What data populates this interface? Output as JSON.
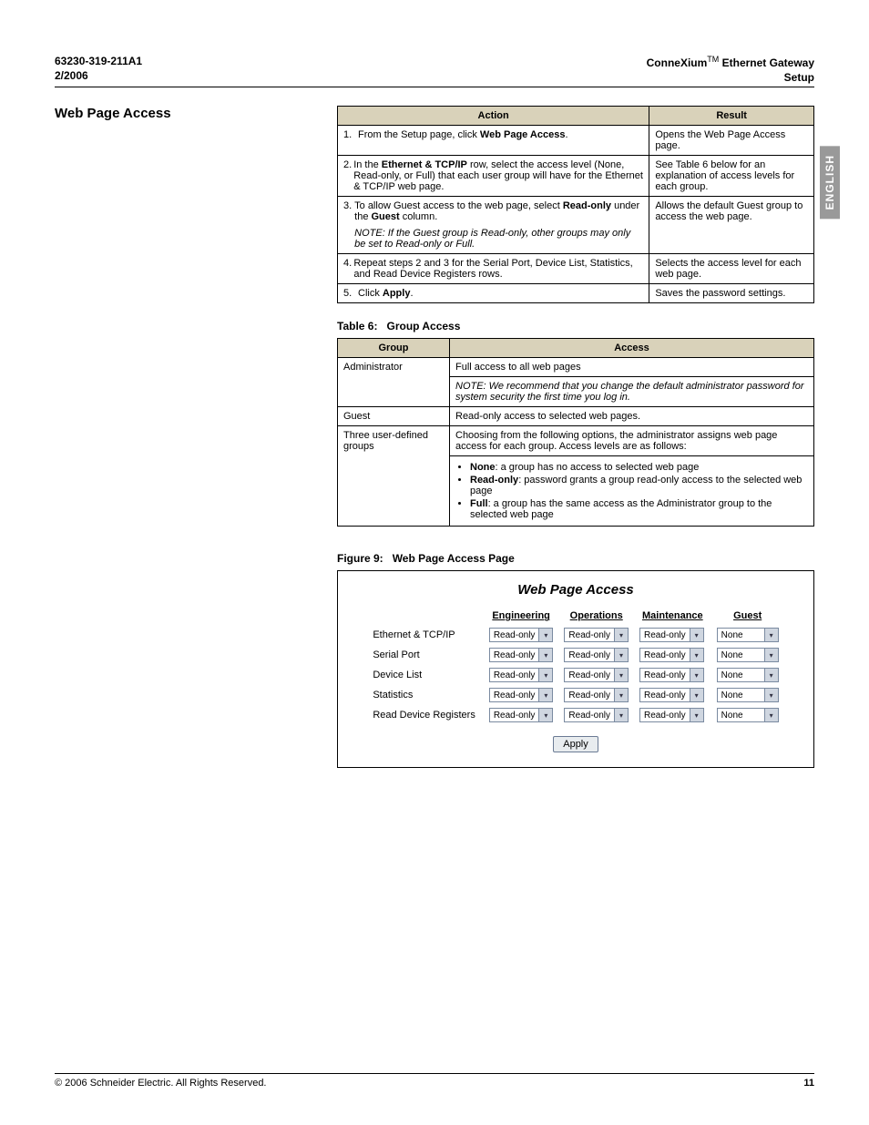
{
  "header": {
    "doc_id": "63230-319-211A1",
    "date": "2/2006",
    "product_pre": "ConneXium",
    "product_tm": "TM",
    "product_post": " Ethernet Gateway",
    "subtitle": "Setup"
  },
  "side_tab": "ENGLISH",
  "section_title": "Web Page Access",
  "action_result": {
    "col_action": "Action",
    "col_result": "Result",
    "rows": [
      {
        "num": "1.",
        "action_pre": "From the Setup page, click ",
        "action_bold": "Web Page Access",
        "action_post": ".",
        "result": "Opens the Web Page Access page."
      },
      {
        "num": "2.",
        "action_pre": "In the ",
        "action_bold": "Ethernet & TCP/IP",
        "action_post": " row, select the access level (None, Read-only, or Full) that each user group will have for the Ethernet & TCP/IP web page.",
        "result": "See Table 6 below for an explanation of access levels for each group."
      },
      {
        "num": "3.",
        "action_line1_pre": "To allow Guest access to the web page, select ",
        "action_line1_bold1": "Read-only",
        "action_line1_mid": " under the ",
        "action_line1_bold2": "Guest",
        "action_line1_post": " column.",
        "action_note": "NOTE: If the Guest group is Read-only, other groups may only be set to Read-only or Full.",
        "result": "Allows the default Guest group to access the web page."
      },
      {
        "num": "4.",
        "action": "Repeat steps 2 and 3 for the Serial Port, Device List, Statistics, and Read Device Registers rows.",
        "result": "Selects the access level for each web page."
      },
      {
        "num": "5.",
        "action_pre": "Click ",
        "action_bold": "Apply",
        "action_post": ".",
        "result": "Saves the password settings."
      }
    ]
  },
  "table6": {
    "label": "Table 6:",
    "title": "Group Access",
    "col_group": "Group",
    "col_access": "Access",
    "rows": {
      "admin_group": "Administrator",
      "admin_access": "Full access to all web pages",
      "admin_note": "NOTE: We recommend that you change the default administrator password for system security the first time you log in.",
      "guest_group": "Guest",
      "guest_access": "Read-only access to selected web pages.",
      "user_group": "Three user-defined groups",
      "user_intro": "Choosing from the following options, the administrator assigns web page access for each group. Access levels are as follows:",
      "opt_none_b": "None",
      "opt_none": ": a group has no access to selected web page",
      "opt_ro_b": "Read-only",
      "opt_ro": ": password grants a group read-only access to the selected web page",
      "opt_full_b": "Full",
      "opt_full": ": a group has the same access as the Administrator group to the selected web page"
    }
  },
  "figure9": {
    "label": "Figure 9:",
    "title": "Web Page Access Page",
    "heading": "Web Page Access",
    "columns": [
      "",
      "Engineering",
      "Operations",
      "Maintenance",
      "Guest"
    ],
    "rows": [
      {
        "label": "Ethernet & TCP/IP",
        "eng": "Read-only",
        "ops": "Read-only",
        "maint": "Read-only",
        "guest": "None"
      },
      {
        "label": "Serial Port",
        "eng": "Read-only",
        "ops": "Read-only",
        "maint": "Read-only",
        "guest": "None"
      },
      {
        "label": "Device List",
        "eng": "Read-only",
        "ops": "Read-only",
        "maint": "Read-only",
        "guest": "None"
      },
      {
        "label": "Statistics",
        "eng": "Read-only",
        "ops": "Read-only",
        "maint": "Read-only",
        "guest": "None"
      },
      {
        "label": "Read Device Registers",
        "eng": "Read-only",
        "ops": "Read-only",
        "maint": "Read-only",
        "guest": "None"
      }
    ],
    "apply": "Apply"
  },
  "footer": {
    "copyright": "© 2006 Schneider Electric. All Rights Reserved.",
    "page": "11"
  }
}
